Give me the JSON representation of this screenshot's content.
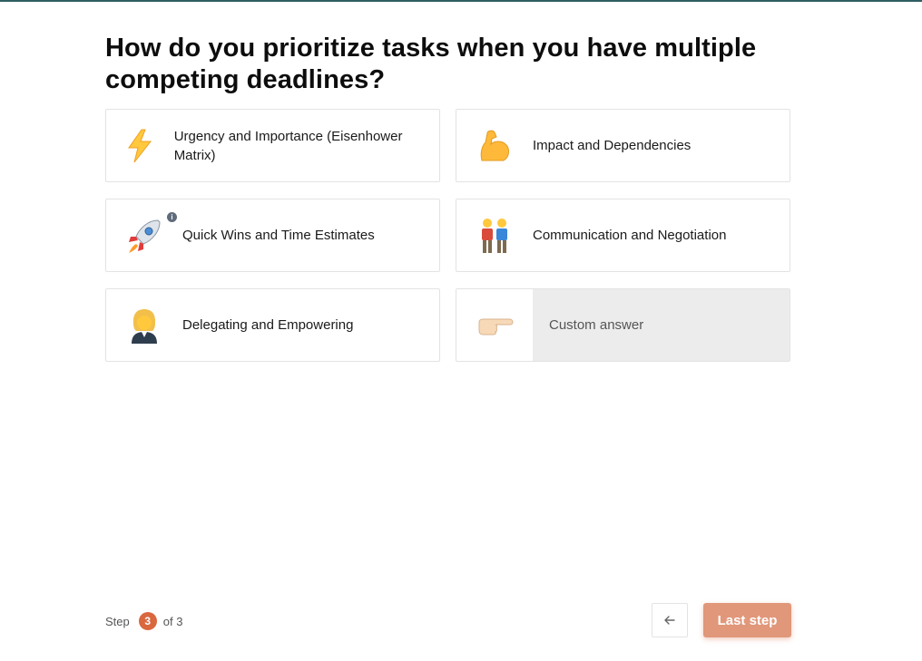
{
  "question": "How do you prioritize tasks when you have multiple competing deadlines?",
  "options": [
    {
      "icon": "lightning-icon",
      "label": "Urgency and Importance (Eisenhower Matrix)"
    },
    {
      "icon": "flexed-biceps-icon",
      "label": "Impact and Dependencies"
    },
    {
      "icon": "rocket-icon",
      "label": "Quick Wins and Time Estimates"
    },
    {
      "icon": "two-people-icon",
      "label": "Communication and Negotiation"
    },
    {
      "icon": "woman-office-worker-icon",
      "label": "Delegating and Empowering"
    }
  ],
  "custom": {
    "icon": "pointing-hand-icon",
    "placeholder": "Custom answer"
  },
  "footer": {
    "step_prefix": "Step",
    "step_current": "3",
    "step_suffix": "of 3",
    "next_label": "Last step"
  },
  "colors": {
    "accent": "#d9683f",
    "button_bg": "#e1977a",
    "custom_bg": "#ececec"
  }
}
